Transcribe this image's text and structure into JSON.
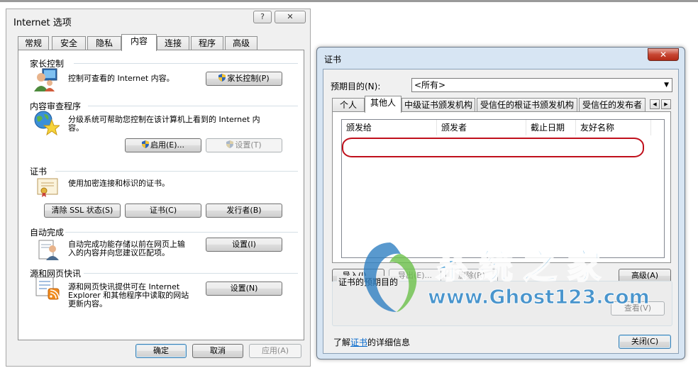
{
  "internet_options": {
    "title": "Internet 选项",
    "help_button": "?",
    "close_button": "✕",
    "tabs": [
      {
        "label": "常规"
      },
      {
        "label": "安全"
      },
      {
        "label": "隐私"
      },
      {
        "label": "内容"
      },
      {
        "label": "连接"
      },
      {
        "label": "程序"
      },
      {
        "label": "高级"
      }
    ],
    "active_tab": "内容",
    "parental": {
      "header": "家长控制",
      "description": "控制可查看的 Internet 内容。",
      "button": "家长控制(P)"
    },
    "content_advisor": {
      "header": "内容审查程序",
      "description_line1": "分级系统可帮助您控制在该计算机上看到的 Internet 内",
      "description_line2": "容。",
      "enable_button": "启用(E)...",
      "settings_button": "设置(T)"
    },
    "certificates": {
      "header": "证书",
      "description": "使用加密连接和标识的证书。",
      "clear_ssl_button": "清除 SSL 状态(S)",
      "certificates_button": "证书(C)",
      "publishers_button": "发行者(B)"
    },
    "autocomplete": {
      "header": "自动完成",
      "description_line1": "自动完成功能存储以前在网页上输",
      "description_line2": "入的内容并向您建议匹配项。",
      "settings_button": "设置(I)"
    },
    "feeds": {
      "header": "源和网页快讯",
      "description_line1": "源和网页快讯提供可在 Internet",
      "description_line2": "Explorer 和其他程序中读取的网站",
      "description_line3": "更新内容。",
      "settings_button": "设置(N)"
    },
    "footer": {
      "ok": "确定",
      "cancel": "取消",
      "apply": "应用(A)"
    }
  },
  "certificates_dialog": {
    "title": "证书",
    "close_button": "✕",
    "purpose_label": "预期目的(N):",
    "purpose_value": "<所有>",
    "tabs": [
      {
        "label": "个人"
      },
      {
        "label": "其他人"
      },
      {
        "label": "中级证书颁发机构"
      },
      {
        "label": "受信任的根证书颁发机构"
      },
      {
        "label": "受信任的发布者"
      }
    ],
    "active_tab": "其他人",
    "columns": [
      {
        "label": "颁发给"
      },
      {
        "label": "颁发者"
      },
      {
        "label": "截止日期"
      },
      {
        "label": "友好名称"
      }
    ],
    "import_button": "导入(I)...",
    "export_button": "导出(E)...",
    "remove_button": "删除(R)",
    "advanced_button": "高级(A)",
    "purposes_group_label": "证书的预期目的",
    "view_button": "查看(V)",
    "learn_prefix": "了解",
    "learn_link": "证书",
    "learn_suffix": "的详细信息",
    "close_label": "关闭(C)",
    "annotation_color": "#c0101c"
  },
  "watermark": {
    "brand_cn": "系统之家",
    "url": "www.Ghost123.com"
  }
}
